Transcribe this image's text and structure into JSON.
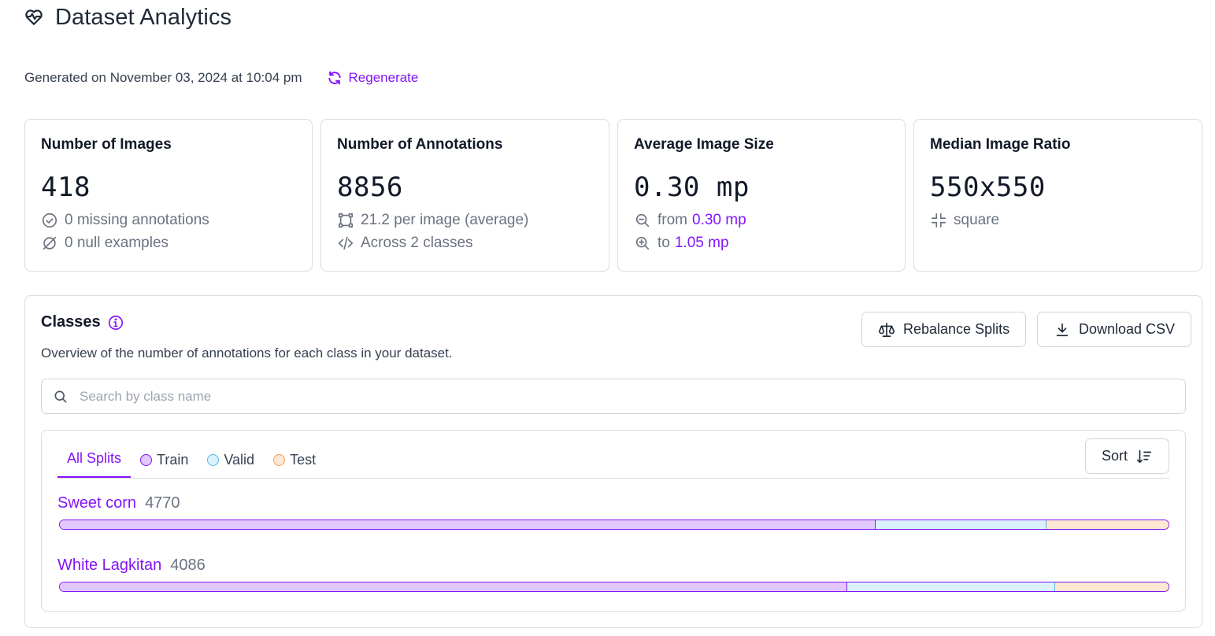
{
  "header": {
    "title": "Dataset Analytics",
    "generated": "Generated on November 03, 2024 at 10:04 pm",
    "regenerate_label": "Regenerate"
  },
  "cards": {
    "images": {
      "title": "Number of Images",
      "value": "418",
      "missing": "0 missing annotations",
      "null": "0 null examples"
    },
    "annotations": {
      "title": "Number of Annotations",
      "value": "8856",
      "per_image": "21.2 per image (average)",
      "classes": "Across 2 classes"
    },
    "size": {
      "title": "Average Image Size",
      "value": "0.30 mp",
      "from_prefix": "from",
      "from_value": "0.30 mp",
      "to_prefix": "to",
      "to_value": "1.05 mp"
    },
    "ratio": {
      "title": "Median Image Ratio",
      "value": "550x550",
      "shape": "square"
    }
  },
  "classes": {
    "title": "Classes",
    "description": "Overview of the number of annotations for each class in your dataset.",
    "rebalance_label": "Rebalance Splits",
    "download_label": "Download CSV",
    "search_placeholder": "Search by class name",
    "tabs": [
      {
        "label": "All Splits"
      },
      {
        "label": "Train"
      },
      {
        "label": "Valid"
      },
      {
        "label": "Test"
      }
    ],
    "sort_label": "Sort",
    "rows": [
      {
        "name": "Sweet corn",
        "count": "4770",
        "train": 0.736,
        "valid": 0.154,
        "test": 0.11
      },
      {
        "name": "White Lagkitan",
        "count": "4086",
        "train": 0.71,
        "valid": 0.188,
        "test": 0.102
      }
    ]
  },
  "colors": {
    "accent": "#8315f9",
    "train": "#e1c7fb",
    "valid": "#dcf2fb",
    "test": "#fde8d4"
  }
}
